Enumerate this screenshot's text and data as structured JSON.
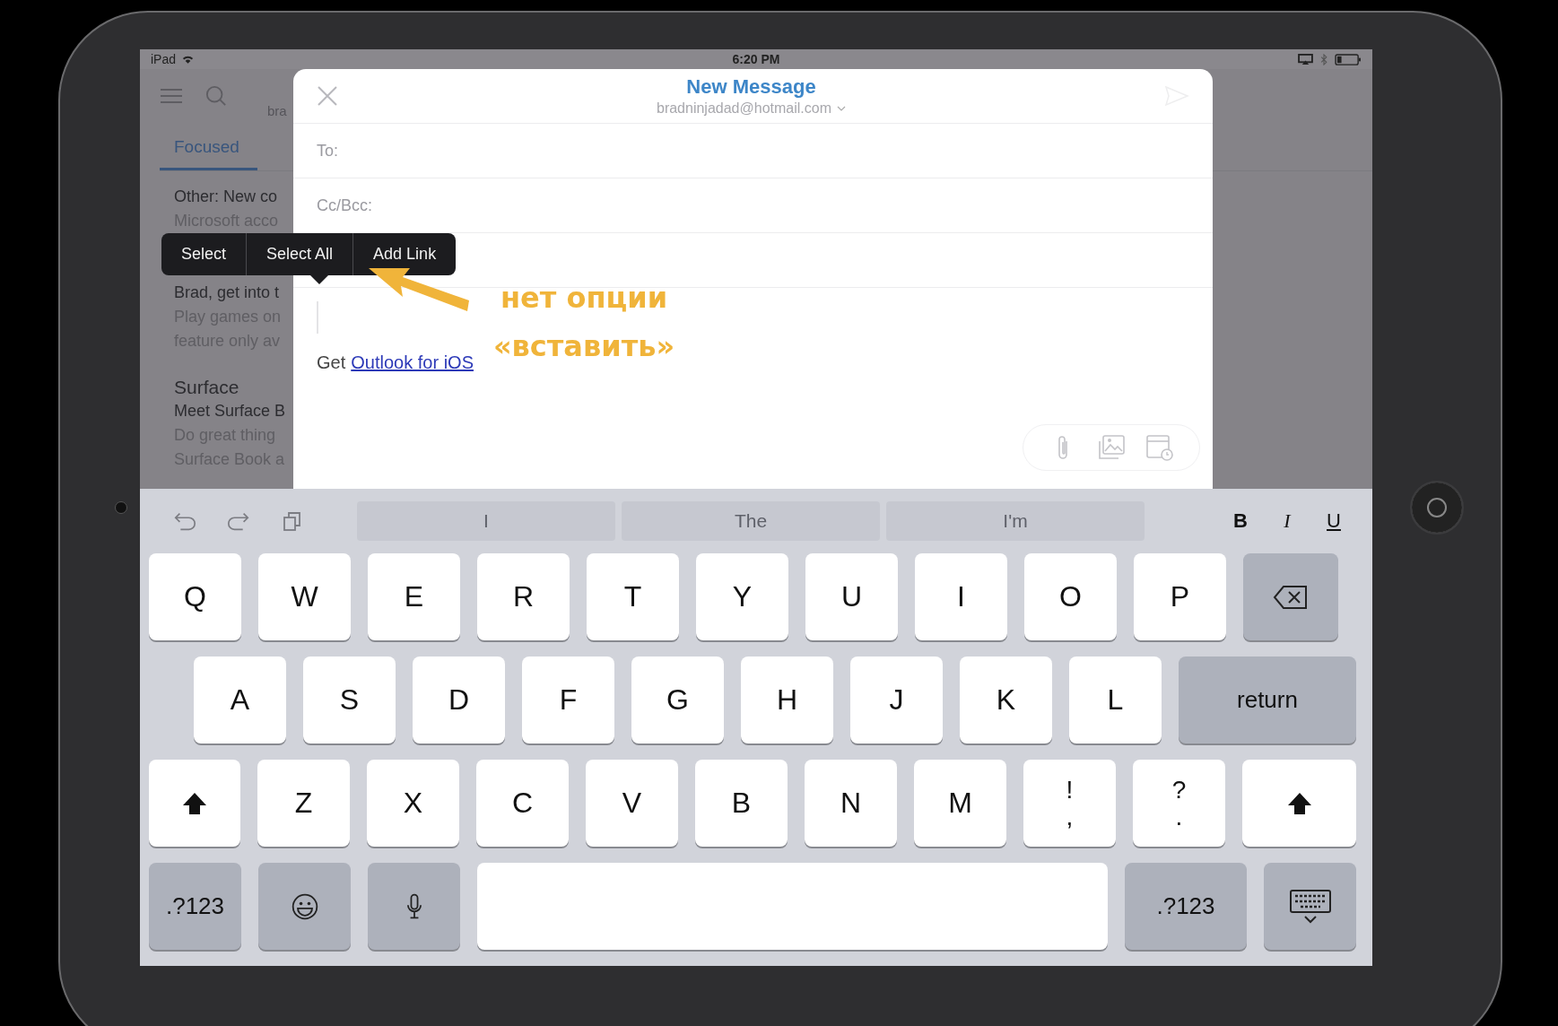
{
  "status_bar": {
    "carrier": "iPad",
    "time": "6:20 PM"
  },
  "background_app": {
    "account": "bra",
    "tabs": [
      {
        "label": "Focused",
        "selected": true
      }
    ],
    "messages": [
      {
        "sender": "Other: New co",
        "preview": [
          "Microsoft acco"
        ]
      },
      {
        "sender": "Brad, get into t",
        "preview": [
          "Play games on",
          "feature only av"
        ]
      },
      {
        "sender": "Surface",
        "subject": "Meet Surface B",
        "preview": [
          "Do great thing",
          "Surface Book a"
        ]
      }
    ]
  },
  "compose": {
    "title": "New Message",
    "from": "bradninjadad@hotmail.com",
    "fields": [
      {
        "kind": "address",
        "label": "To:"
      },
      {
        "kind": "address",
        "label": "Cc/Bcc:"
      },
      {
        "kind": "subject"
      }
    ],
    "body": {
      "prefix": "Get",
      "link": "Outlook for iOS"
    }
  },
  "context_menu": {
    "items": [
      {
        "label": "Select"
      },
      {
        "label": "Select All"
      },
      {
        "label": "Add Link"
      }
    ]
  },
  "annotation": {
    "lines": [
      "нет опции",
      "«вставить»"
    ]
  },
  "keyboard": {
    "suggestions": [
      "I",
      "The",
      "I'm"
    ],
    "format": [
      {
        "label": "B",
        "kind": "bold"
      },
      {
        "label": "I",
        "kind": "italic"
      },
      {
        "label": "U",
        "kind": "underline"
      }
    ],
    "rows": [
      {
        "keys": [
          {
            "kind": "letter",
            "label": "Q"
          },
          {
            "kind": "letter",
            "label": "W"
          },
          {
            "kind": "letter",
            "label": "E"
          },
          {
            "kind": "letter",
            "label": "R"
          },
          {
            "kind": "letter",
            "label": "T"
          },
          {
            "kind": "letter",
            "label": "Y"
          },
          {
            "kind": "letter",
            "label": "U"
          },
          {
            "kind": "letter",
            "label": "I"
          },
          {
            "kind": "letter",
            "label": "O"
          },
          {
            "kind": "letter",
            "label": "P"
          },
          {
            "kind": "backspace"
          }
        ]
      },
      {
        "keys": [
          {
            "kind": "letter",
            "label": "A"
          },
          {
            "kind": "letter",
            "label": "S"
          },
          {
            "kind": "letter",
            "label": "D"
          },
          {
            "kind": "letter",
            "label": "F"
          },
          {
            "kind": "letter",
            "label": "G"
          },
          {
            "kind": "letter",
            "label": "H"
          },
          {
            "kind": "letter",
            "label": "J"
          },
          {
            "kind": "letter",
            "label": "K"
          },
          {
            "kind": "letter",
            "label": "L"
          },
          {
            "kind": "return",
            "label": "return"
          }
        ]
      },
      {
        "keys": [
          {
            "kind": "shift"
          },
          {
            "kind": "letter",
            "label": "Z"
          },
          {
            "kind": "letter",
            "label": "X"
          },
          {
            "kind": "letter",
            "label": "C"
          },
          {
            "kind": "letter",
            "label": "V"
          },
          {
            "kind": "letter",
            "label": "B"
          },
          {
            "kind": "letter",
            "label": "N"
          },
          {
            "kind": "letter",
            "label": "M"
          },
          {
            "kind": "punct",
            "top": "!",
            "bottom": ","
          },
          {
            "kind": "punct",
            "top": "?",
            "bottom": "."
          },
          {
            "kind": "shift"
          }
        ]
      },
      {
        "keys": [
          {
            "kind": "mode",
            "label": ".?123"
          },
          {
            "kind": "emoji"
          },
          {
            "kind": "mic"
          },
          {
            "kind": "space"
          },
          {
            "kind": "mode",
            "label": ".?123"
          },
          {
            "kind": "dismiss"
          }
        ]
      }
    ]
  }
}
